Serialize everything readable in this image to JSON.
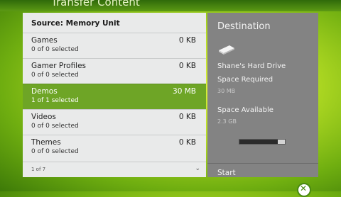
{
  "header": {
    "title": "Transfer Content"
  },
  "source_label": "Source: Memory Unit",
  "items": [
    {
      "name": "Games",
      "sub": "0 of 0 selected",
      "size": "0 KB",
      "selected": false
    },
    {
      "name": "Gamer Profiles",
      "sub": "0 of 0 selected",
      "size": "0 KB",
      "selected": false
    },
    {
      "name": "Demos",
      "sub": "1 of 1 selected",
      "size": "30 MB",
      "selected": true
    },
    {
      "name": "Videos",
      "sub": "0 of 0 selected",
      "size": "0 KB",
      "selected": false
    },
    {
      "name": "Themes",
      "sub": "0 of 0 selected",
      "size": "0 KB",
      "selected": false
    }
  ],
  "pager": "1 of 7",
  "destination": {
    "title": "Destination",
    "drive": "Shane's Hard Drive",
    "space_required_label": "Space Required",
    "space_required_value": "30 MB",
    "space_available_label": "Space Available",
    "space_available_value": "2.3 GB",
    "progress_fraction": 0.84,
    "start_label": "Start"
  },
  "colors": {
    "accent": "#6ea526",
    "panel_right": "#838383",
    "panel_left": "#e9eaea"
  },
  "icons": {
    "drive": "hard-drive-icon",
    "scroll": "chevron-down-icon",
    "logo": "xbox-logo-icon"
  }
}
